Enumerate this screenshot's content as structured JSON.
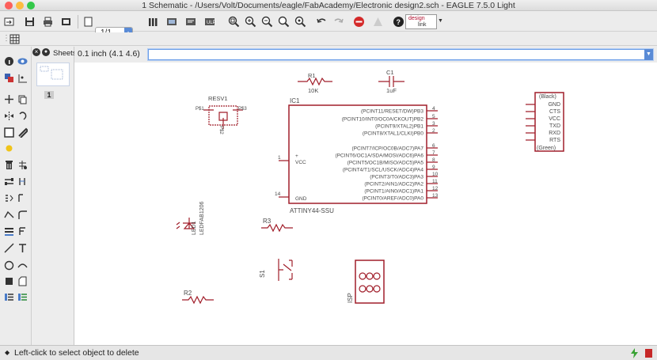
{
  "window": {
    "title": "1 Schematic - /Users/Volt/Documents/eagle/FabAcademy/Electronic design2.sch - EAGLE 7.5.0 Light"
  },
  "toolbar": {
    "sheet_select": "1/1",
    "designlink_top": "design",
    "designlink_bottom": "link"
  },
  "command_bar": {
    "grid_coord": "0.1 inch (4.1 4.6)",
    "command_value": ""
  },
  "sheets_panel": {
    "label": "Sheets",
    "sheet_number": "1"
  },
  "schematic": {
    "resistor_r1": {
      "name": "R1",
      "value": "10K"
    },
    "capacitor_c1": {
      "name": "C1",
      "value": "1uF"
    },
    "resonator": {
      "name": "RESV1",
      "pin_left": "P$1",
      "pin_right": "P$3",
      "pin_bottom": "P$2"
    },
    "ic": {
      "name": "IC1",
      "part": "ATTINY44-SSU",
      "left_pins": [
        {
          "num": "1",
          "name": "VCC"
        },
        {
          "num": "14",
          "name": "GND"
        }
      ],
      "right_pins": [
        {
          "num": "4",
          "name": "(PCINT11/RESET/DW)PB3"
        },
        {
          "num": "5",
          "name": "(PCINT10/INT0/OC0A/CKOUT)PB2"
        },
        {
          "num": "3",
          "name": "(PCINT9/XTAL2)PB1"
        },
        {
          "num": "2",
          "name": "(PCINT8/XTAL1/CLKI)PB0"
        },
        {
          "num": "6",
          "name": "(PCINT7/ICP/OC0B/ADC7)PA7"
        },
        {
          "num": "7",
          "name": "(PCINT6/OC1A/SDA/MOSI/ADC6)PA6"
        },
        {
          "num": "8",
          "name": "(PCINT5/OC1B/MISO/ADC5)PA5"
        },
        {
          "num": "9",
          "name": "(PCINT4/T1/SCL/USCK/ADC4)PA4"
        },
        {
          "num": "10",
          "name": "(PCINT3/T0/ADC3)PA3"
        },
        {
          "num": "11",
          "name": "(PCINT2/AIN1/ADC2)PA2"
        },
        {
          "num": "12",
          "name": "(PCINT1/AIN0/ADC1)PA1"
        },
        {
          "num": "13",
          "name": "(PCINT0/AREF/ADC0)PA0"
        }
      ]
    },
    "ftdi_header": {
      "top_label": "(Black)",
      "pins": [
        "GND",
        "CTS",
        "VCC",
        "TXD",
        "RXD",
        "RTS"
      ],
      "bottom_label": "(Green)"
    },
    "led": {
      "name": "LED1",
      "value": "LEDFAB1206"
    },
    "resistor_r3": {
      "name": "R3"
    },
    "switch_s1": {
      "name": "S1"
    },
    "resistor_r2": {
      "name": "R2"
    },
    "isp": {
      "name": "ISP"
    }
  },
  "status": {
    "message": "Left-click to select object to delete"
  },
  "colors": {
    "part": "#a11e2a",
    "text": "#4a4a4a",
    "selection": "#6c9ee8"
  }
}
